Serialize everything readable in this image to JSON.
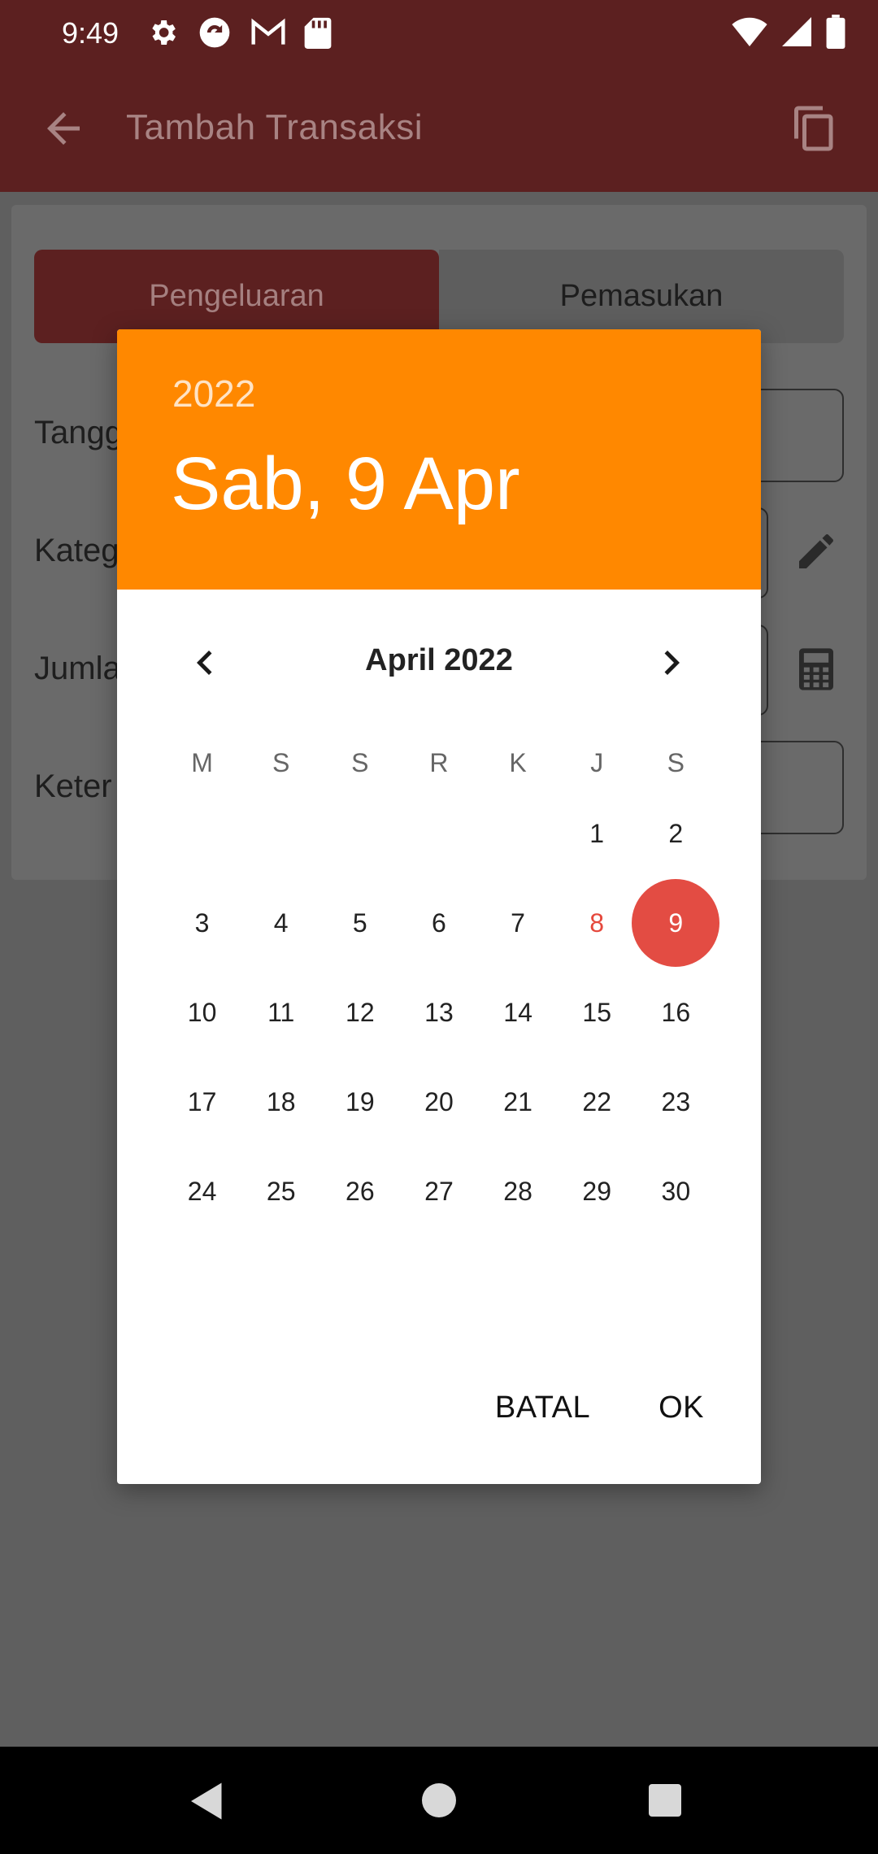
{
  "status": {
    "time": "9:49"
  },
  "appbar": {
    "title": "Tambah Transaksi"
  },
  "tabs": {
    "expense": "Pengeluaran",
    "income": "Pemasukan"
  },
  "form": {
    "labels": {
      "date": "Tangg",
      "category": "Kateg",
      "amount": "Jumla",
      "note": "Keter"
    }
  },
  "dialog": {
    "year": "2022",
    "selected_date": "Sab, 9 Apr",
    "month_label": "April 2022",
    "weekdays": [
      "M",
      "S",
      "S",
      "R",
      "K",
      "J",
      "S"
    ],
    "weeks": [
      [
        "",
        "",
        "",
        "",
        "",
        "1",
        "2"
      ],
      [
        "3",
        "4",
        "5",
        "6",
        "7",
        "8",
        "9"
      ],
      [
        "10",
        "11",
        "12",
        "13",
        "14",
        "15",
        "16"
      ],
      [
        "17",
        "18",
        "19",
        "20",
        "21",
        "22",
        "23"
      ],
      [
        "24",
        "25",
        "26",
        "27",
        "28",
        "29",
        "30"
      ]
    ],
    "today": "8",
    "selected": "9",
    "cancel_label": "BATAL",
    "ok_label": "OK"
  },
  "colors": {
    "header": "#ff8800",
    "selected": "#e34c43",
    "appbar": "#5c2020"
  }
}
